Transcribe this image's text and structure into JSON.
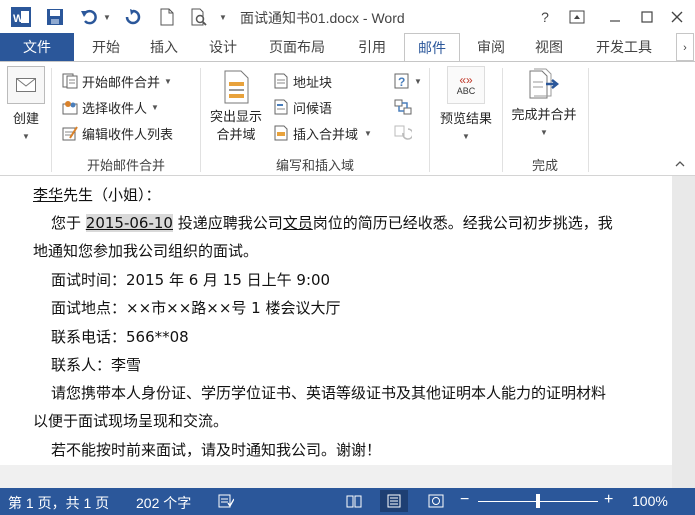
{
  "titlebar": {
    "title": "面试通知书01.docx - Word",
    "help": "?",
    "restore_ribbon": "▣",
    "minimize": "—",
    "maximize": "☐",
    "close": "✕"
  },
  "tabs": {
    "file": "文件",
    "home": "开始",
    "insert": "插入",
    "design": "设计",
    "layout": "页面布局",
    "references": "引用",
    "mailings": "邮件",
    "review": "审阅",
    "view": "视图",
    "developer": "开发工具"
  },
  "ribbon": {
    "create": "创建",
    "start_merge": "开始邮件合并",
    "select_recipients": "选择收件人",
    "edit_recipients": "编辑收件人列表",
    "group_start": "开始邮件合并",
    "highlight_line1": "突出显示",
    "highlight_line2": "合并域",
    "address_block": "地址块",
    "greeting_line": "问候语",
    "insert_merge_field": "插入合并域",
    "group_write": "编写和插入域",
    "preview_results": "预览结果",
    "preview_abc": "ABC",
    "preview_arrows": "«»",
    "finish_merge": "完成并合并",
    "group_finish": "完成"
  },
  "document": {
    "l1_name": "李华",
    "l1_rest": "先生（小姐）：",
    "l2_pre": "您于 ",
    "l2_date": "2015-06-10",
    "l2_mid": " 投递应聘我公司",
    "l2_job": "文员",
    "l2_post": "岗位的简历已经收悉。经我公司初步挑选，我",
    "l3": "地通知您参加我公司组织的面试。",
    "l4": "面试时间：2015 年 6 月 15 日上午 9:00",
    "l5": "面试地点：××市××路××号 1 楼会议大厅",
    "l6": "联系电话：566**08",
    "l7": "联系人：李雪",
    "l8": "请您携带本人身份证、学历学位证书、英语等级证书及其他证明本人能力的证明材料",
    "l9": "以便于面试现场呈现和交流。",
    "l10": "若不能按时前来面试，请及时通知我公司。谢谢！"
  },
  "status": {
    "page": "第 1 页，共 1 页",
    "words": "202 个字",
    "zoom": "100%",
    "zoom_level": 0.5
  },
  "colors": {
    "accent": "#2b579a"
  }
}
